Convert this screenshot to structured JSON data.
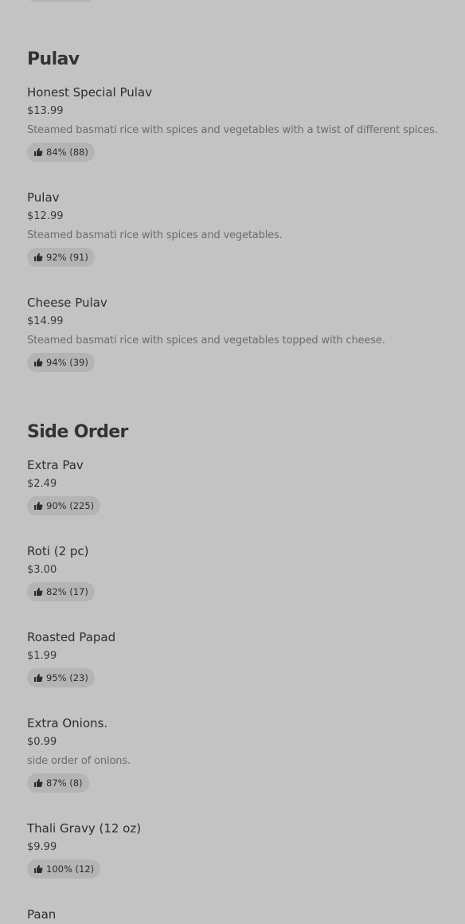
{
  "sections": [
    {
      "title": "Pulav",
      "items": [
        {
          "name": "Honest Special Pulav",
          "price": "$13.99",
          "description": "Steamed basmati rice with spices and vegetables with a twist of different spices.",
          "rating": "84% (88)"
        },
        {
          "name": "Pulav",
          "price": "$12.99",
          "description": "Steamed basmati rice with spices and vegetables.",
          "rating": "92% (91)"
        },
        {
          "name": "Cheese Pulav",
          "price": "$14.99",
          "description": "Steamed basmati rice with spices and vegetables topped with cheese.",
          "rating": "94% (39)"
        }
      ]
    },
    {
      "title": "Side Order",
      "items": [
        {
          "name": "Extra Pav",
          "price": "$2.49",
          "rating": "90% (225)"
        },
        {
          "name": "Roti (2 pc)",
          "price": "$3.00",
          "rating": "82% (17)"
        },
        {
          "name": "Roasted Papad",
          "price": "$1.99",
          "rating": "95% (23)"
        },
        {
          "name": "Extra Onions.",
          "price": "$0.99",
          "description": "side order of onions.",
          "rating": "87% (8)"
        },
        {
          "name": "Thali Gravy (12 oz)",
          "price": "$9.99",
          "rating": "100% (12)"
        },
        {
          "name": "Paan"
        }
      ]
    }
  ],
  "icons": {
    "rating": "thumbs-up-icon"
  }
}
